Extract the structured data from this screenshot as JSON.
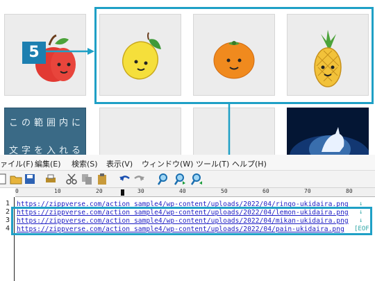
{
  "callout": {
    "step_number": "5"
  },
  "fruit_tiles": [
    {
      "icon": "apple-icon"
    },
    {
      "icon": "lemon-icon"
    },
    {
      "icon": "mikan-orange-icon"
    },
    {
      "icon": "pineapple-icon"
    }
  ],
  "lower_tiles": {
    "text_box_lines": [
      "この範囲内に",
      "文字を入れると"
    ]
  },
  "menu": [
    "ァイル(F)",
    "編集(E)",
    "検索(S)",
    "表示(V)",
    "ウィンドウ(W)",
    "ツール(T)",
    "ヘルプ(H)"
  ],
  "ruler": {
    "marks": [
      "0",
      "10",
      "20",
      "30",
      "40",
      "50",
      "60",
      "70",
      "80"
    ]
  },
  "editor": {
    "lines": [
      {
        "num": "1",
        "text": "https://zippverse.com/action sample4/wp-content/uploads/2022/04/ringo-ukidaira.png",
        "eol": "↓"
      },
      {
        "num": "2",
        "text": "https://zippverse.com/action sample4/wp-content/uploads/2022/04/lemon-ukidaira.png",
        "eol": "↓"
      },
      {
        "num": "3",
        "text": "https://zippverse.com/action sample4/wp-content/uploads/2022/04/mikan-ukidaira.png",
        "eol": "↓"
      },
      {
        "num": "4",
        "text": "https://zippverse.com/action sample4/wp-content/uploads/2022/04/pain-ukidaira.png",
        "eol": "[EOF]"
      }
    ]
  },
  "colors": {
    "accent": "#1fa0c6",
    "badge": "#1d7fb0",
    "link": "#1c1cc4"
  }
}
